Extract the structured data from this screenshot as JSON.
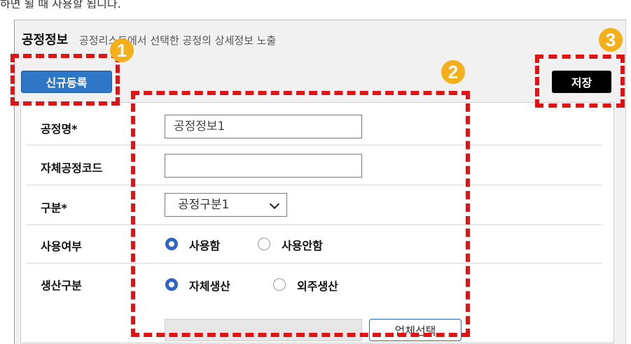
{
  "top_cut_text": "하면 될 때 사용할 됩니다.",
  "panel": {
    "title": "공정정보",
    "description": "공정리스트에서 선택한 공정의 상세정보 노출"
  },
  "buttons": {
    "new": "신규등록",
    "save": "저장",
    "vendor_select": "업체선택"
  },
  "form": {
    "process_name": {
      "label": "공정명*",
      "value": "공정정보1"
    },
    "own_code": {
      "label": "자체공정코드",
      "value": ""
    },
    "category": {
      "label": "구분*",
      "selected": "공정구분1"
    },
    "usage": {
      "label": "사용여부",
      "options": [
        "사용함",
        "사용안함"
      ],
      "selected": "사용함"
    },
    "production_type": {
      "label": "생산구분",
      "options": [
        "자체생산",
        "외주생산"
      ],
      "selected": "자체생산"
    }
  },
  "annotations": {
    "badge1": "1",
    "badge2": "2",
    "badge3": "3"
  },
  "colors": {
    "highlight": "#e01414",
    "badge": "#f3b01a",
    "primary": "#2f77c6"
  }
}
